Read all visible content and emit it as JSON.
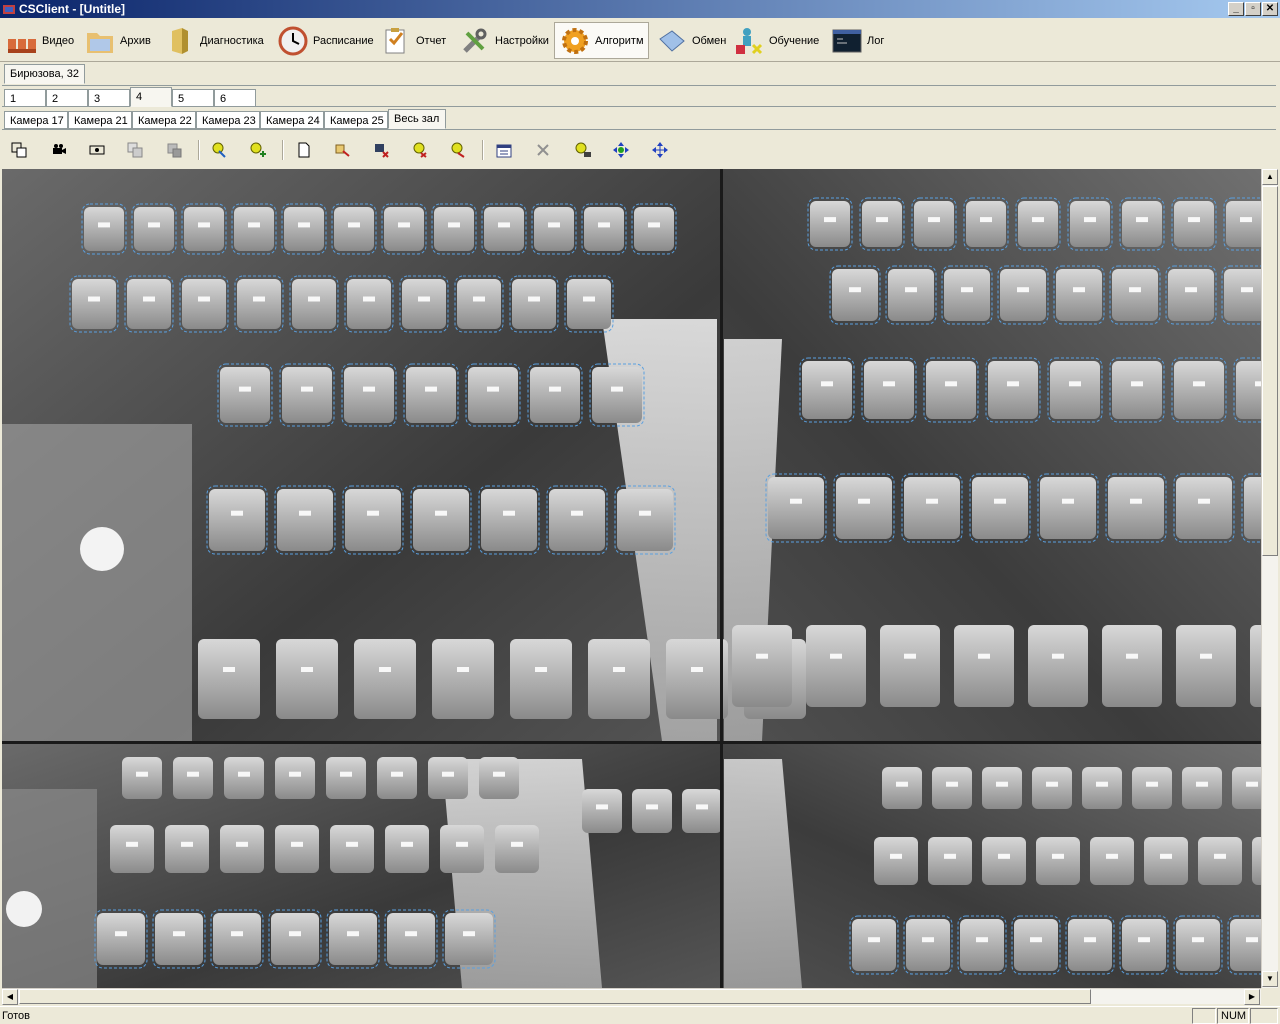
{
  "window": {
    "title": "CSClient - [Untitle]",
    "min": "_",
    "restore": "▫",
    "close": "✕"
  },
  "main_toolbar": [
    {
      "label": "Видео",
      "icon": "seats-icon"
    },
    {
      "label": "Архив",
      "icon": "archive-folder-icon"
    },
    {
      "label": "Диагностика",
      "icon": "server-icon"
    },
    {
      "label": "Расписание",
      "icon": "clock-icon"
    },
    {
      "label": "Отчет",
      "icon": "report-icon"
    },
    {
      "label": "Настройки",
      "icon": "tools-icon"
    },
    {
      "label": "Алгоритм",
      "icon": "gear-icon",
      "active": true
    },
    {
      "label": "Обмен",
      "icon": "exchange-icon"
    },
    {
      "label": "Обучение",
      "icon": "training-icon"
    },
    {
      "label": "Лог",
      "icon": "console-icon"
    }
  ],
  "site_tabs": [
    {
      "label": "Бирюзова, 32",
      "active": true
    }
  ],
  "page_tabs": [
    {
      "label": "1"
    },
    {
      "label": "2"
    },
    {
      "label": "3"
    },
    {
      "label": "4",
      "active": true
    },
    {
      "label": "5"
    },
    {
      "label": "6"
    }
  ],
  "camera_tabs": [
    {
      "label": "Камера 17"
    },
    {
      "label": "Камера 21"
    },
    {
      "label": "Камера 22"
    },
    {
      "label": "Камера 23"
    },
    {
      "label": "Камера 24"
    },
    {
      "label": "Камера 25"
    },
    {
      "label": "Весь зал",
      "active": true
    }
  ],
  "icon_toolbar": [
    "layers-icon",
    "camera-icon",
    "record-icon",
    "copy-icon",
    "paste-icon",
    "select-zone-icon",
    "add-zone-icon",
    "new-page-icon",
    "edit-page-icon",
    "delete-page-icon",
    "bulb-icon",
    "bulb-edit-icon",
    "properties-icon",
    "delete-icon",
    "user-zone-icon",
    "move-arrows-icon",
    "expand-arrows-icon"
  ],
  "status": {
    "text": "Готов",
    "num": "NUM"
  }
}
